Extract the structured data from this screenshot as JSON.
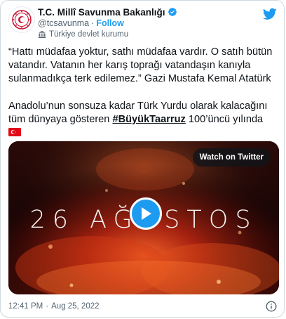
{
  "account": {
    "display_name": "T.C. Millî Savunma Bakanlığı",
    "handle": "@tcsavunma",
    "separator": "·",
    "follow_label": "Follow",
    "label": "Türkiye devlet kurumu"
  },
  "tweet": {
    "paragraph1": "“Hattı müdafaa yoktur, sathı müdafaa vardır. O satıh bütün vatandır. Vatanın her karış toprağı vatandaşın kanıyla sulanmadıkça terk edilemez.” Gazi Mustafa Kemal Atatürk",
    "paragraph2_before": "Anadolu’nun sonsuza kadar Türk Yurdu olarak kalacağını tüm dünyaya gösteren ",
    "hashtag": "#BüyükTaarruz",
    "paragraph2_after": " 100’üncü yılında"
  },
  "media": {
    "watch_label": "Watch on Twitter",
    "video_title": "26 AĞUSTOS"
  },
  "footer": {
    "time": "12:41 PM",
    "separator": "·",
    "date": "Aug 25, 2022"
  },
  "colors": {
    "accent": "#1d9bf0",
    "text": "#0f1419",
    "secondary": "#536471",
    "flag_red": "#e30a17"
  },
  "icons": {
    "verified": "verified-badge-icon",
    "logo": "twitter-bird-icon",
    "affiliation": "government-building-icon",
    "play": "play-icon",
    "info": "info-icon"
  }
}
